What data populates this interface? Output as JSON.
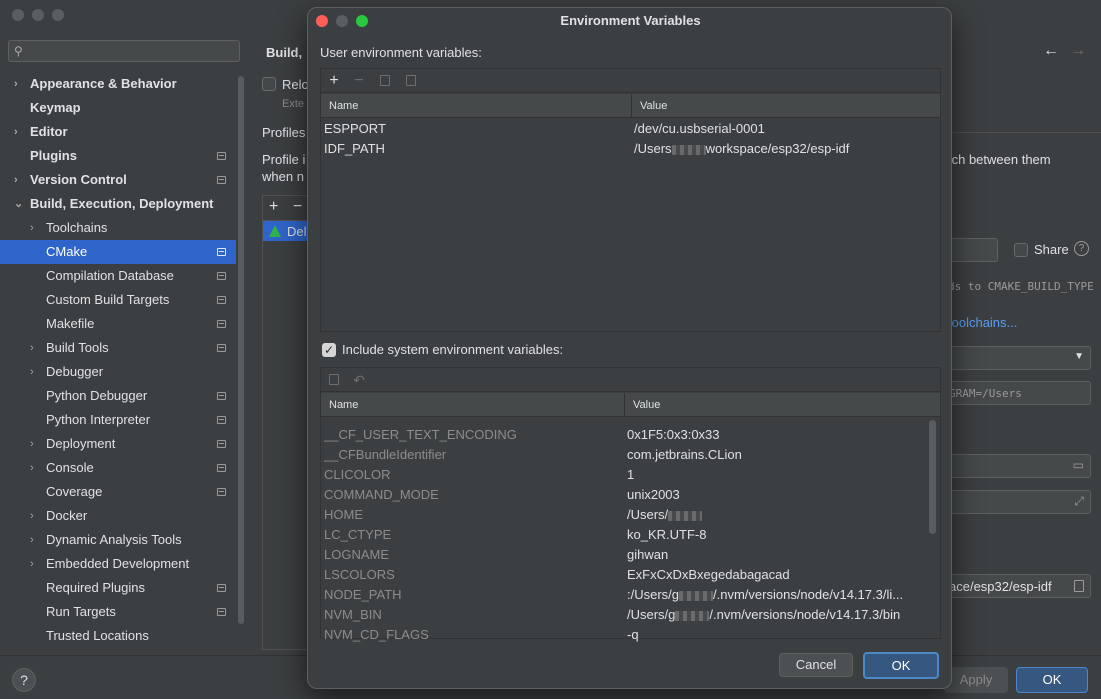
{
  "settings": {
    "search_placeholder": "",
    "sidebar": {
      "items": [
        {
          "label": "Appearance & Behavior",
          "chevron": "›",
          "bold": true,
          "level": 0
        },
        {
          "label": "Keymap",
          "chevron": "",
          "bold": true,
          "level": 0
        },
        {
          "label": "Editor",
          "chevron": "›",
          "bold": true,
          "level": 0
        },
        {
          "label": "Plugins",
          "chevron": "",
          "bold": true,
          "level": 0,
          "cfg": true
        },
        {
          "label": "Version Control",
          "chevron": "›",
          "bold": true,
          "level": 0,
          "cfg": true
        },
        {
          "label": "Build, Execution, Deployment",
          "chevron": "⌄",
          "bold": true,
          "level": 0
        },
        {
          "label": "Toolchains",
          "chevron": "›",
          "level": 1
        },
        {
          "label": "CMake",
          "chevron": "",
          "level": 1,
          "cfg": true,
          "selected": true
        },
        {
          "label": "Compilation Database",
          "chevron": "",
          "level": 1,
          "cfg": true
        },
        {
          "label": "Custom Build Targets",
          "chevron": "",
          "level": 1,
          "cfg": true
        },
        {
          "label": "Makefile",
          "chevron": "",
          "level": 1,
          "cfg": true
        },
        {
          "label": "Build Tools",
          "chevron": "›",
          "level": 1,
          "cfg": true
        },
        {
          "label": "Debugger",
          "chevron": "›",
          "level": 1
        },
        {
          "label": "Python Debugger",
          "chevron": "",
          "level": 1,
          "cfg": true
        },
        {
          "label": "Python Interpreter",
          "chevron": "",
          "level": 1,
          "cfg": true
        },
        {
          "label": "Deployment",
          "chevron": "›",
          "level": 1,
          "cfg": true
        },
        {
          "label": "Console",
          "chevron": "›",
          "level": 1,
          "cfg": true
        },
        {
          "label": "Coverage",
          "chevron": "",
          "level": 1,
          "cfg": true
        },
        {
          "label": "Docker",
          "chevron": "›",
          "level": 1
        },
        {
          "label": "Dynamic Analysis Tools",
          "chevron": "›",
          "level": 1
        },
        {
          "label": "Embedded Development",
          "chevron": "›",
          "level": 1
        },
        {
          "label": "Required Plugins",
          "chevron": "",
          "level": 1,
          "cfg": true
        },
        {
          "label": "Run Targets",
          "chevron": "",
          "level": 1,
          "cfg": true
        },
        {
          "label": "Trusted Locations",
          "chevron": "",
          "level": 1
        }
      ]
    },
    "content": {
      "heading": "Build,",
      "reload_label": "Relo",
      "reload_sub": "Exte",
      "profiles_label": "Profiles",
      "profile_desc_1": "Profile i",
      "profile_desc_2": "when n",
      "switch_text": "tch between them",
      "share_label": "Share",
      "cmake_build_type": "ds to CMAKE_BUILD_TYPE",
      "toolchains_link": "toolchains...",
      "cmake_opts": "GRAM=/Users",
      "profile_item": "Del",
      "env_path": "ace/esp32/esp-idf"
    },
    "footer": {
      "help": "?",
      "apply": "Apply",
      "ok": "OK"
    }
  },
  "dialog": {
    "title": "Environment Variables",
    "user_section_label": "User environment variables:",
    "columns": {
      "name": "Name",
      "value": "Value"
    },
    "user_vars": [
      {
        "name": "ESPPORT",
        "value_pre": "/dev/cu.usbserial-0001",
        "value_post": ""
      },
      {
        "name": "IDF_PATH",
        "value_pre": "/Users",
        "value_post": "workspace/esp32/esp-idf"
      }
    ],
    "include_system_label": "Include system environment variables:",
    "system_vars": [
      {
        "name": "__CF_USER_TEXT_ENCODING",
        "value_pre": "0x1F5:0x3:0x33",
        "value_post": ""
      },
      {
        "name": "__CFBundleIdentifier",
        "value_pre": "com.jetbrains.CLion",
        "value_post": ""
      },
      {
        "name": "CLICOLOR",
        "value_pre": "1",
        "value_post": ""
      },
      {
        "name": "COMMAND_MODE",
        "value_pre": "unix2003",
        "value_post": ""
      },
      {
        "name": "HOME",
        "value_pre": "/Users/",
        "value_post": ""
      },
      {
        "name": "LC_CTYPE",
        "value_pre": "ko_KR.UTF-8",
        "value_post": ""
      },
      {
        "name": "LOGNAME",
        "value_pre": "gihwan",
        "value_post": ""
      },
      {
        "name": "LSCOLORS",
        "value_pre": "ExFxCxDxBxegedabagacad",
        "value_post": ""
      },
      {
        "name": "NODE_PATH",
        "value_pre": ":/Users/g",
        "value_post": "/.nvm/versions/node/v14.17.3/li..."
      },
      {
        "name": "NVM_BIN",
        "value_pre": "/Users/g",
        "value_post": "/.nvm/versions/node/v14.17.3/bin"
      },
      {
        "name": "NVM_CD_FLAGS",
        "value_pre": "-q",
        "value_post": ""
      }
    ],
    "cancel_label": "Cancel",
    "ok_label": "OK",
    "colors": {
      "close": "#ff5f57",
      "minimize": "#febc2e",
      "zoom": "#28c840",
      "accent": "#2f65ca"
    }
  }
}
